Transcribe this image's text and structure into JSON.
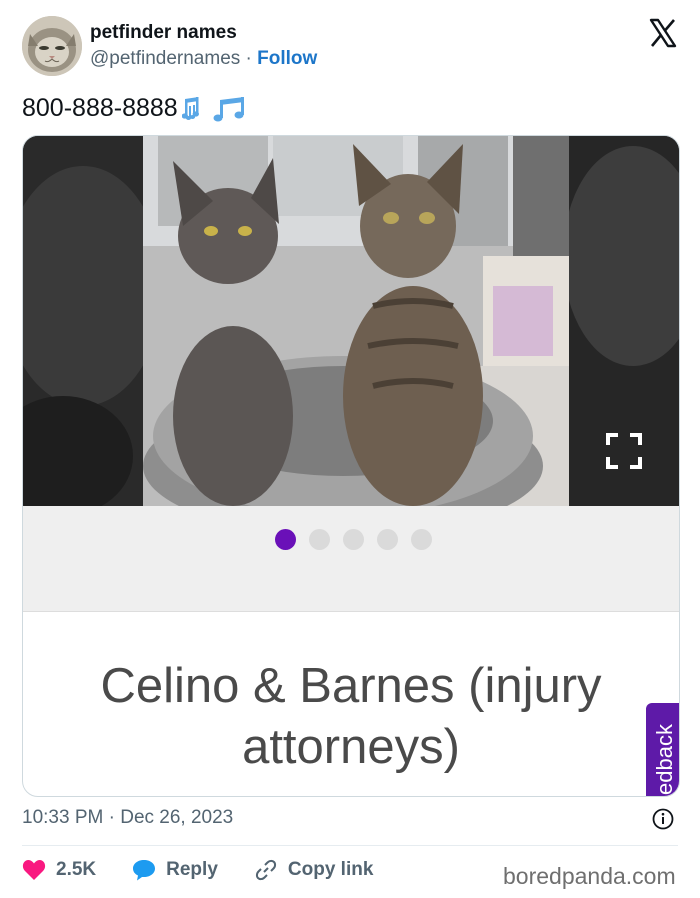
{
  "author": {
    "display_name": "petfinder names",
    "handle": "@petfindernames",
    "separator": " · ",
    "follow_label": "Follow"
  },
  "tweet": {
    "text": "800-888-8888",
    "emoji": "musical-notes"
  },
  "media": {
    "caption_line1": "Celino & Barnes (injury",
    "caption_line2": "attorneys)",
    "carousel": {
      "count": 5,
      "active_index": 0
    },
    "feedback_label": "edback"
  },
  "meta": {
    "time": "10:33 PM",
    "separator": " · ",
    "date": "Dec 26, 2023"
  },
  "actions": {
    "like_count": "2.5K",
    "reply_label": "Reply",
    "copy_label": "Copy link"
  },
  "watermark": "boredpanda.com",
  "colors": {
    "follow": "#1d76c9",
    "like": "#f91880",
    "reply_icon": "#1d9bf0",
    "carousel_active": "#6a10b8",
    "feedback_bg": "#5e1aa8"
  }
}
